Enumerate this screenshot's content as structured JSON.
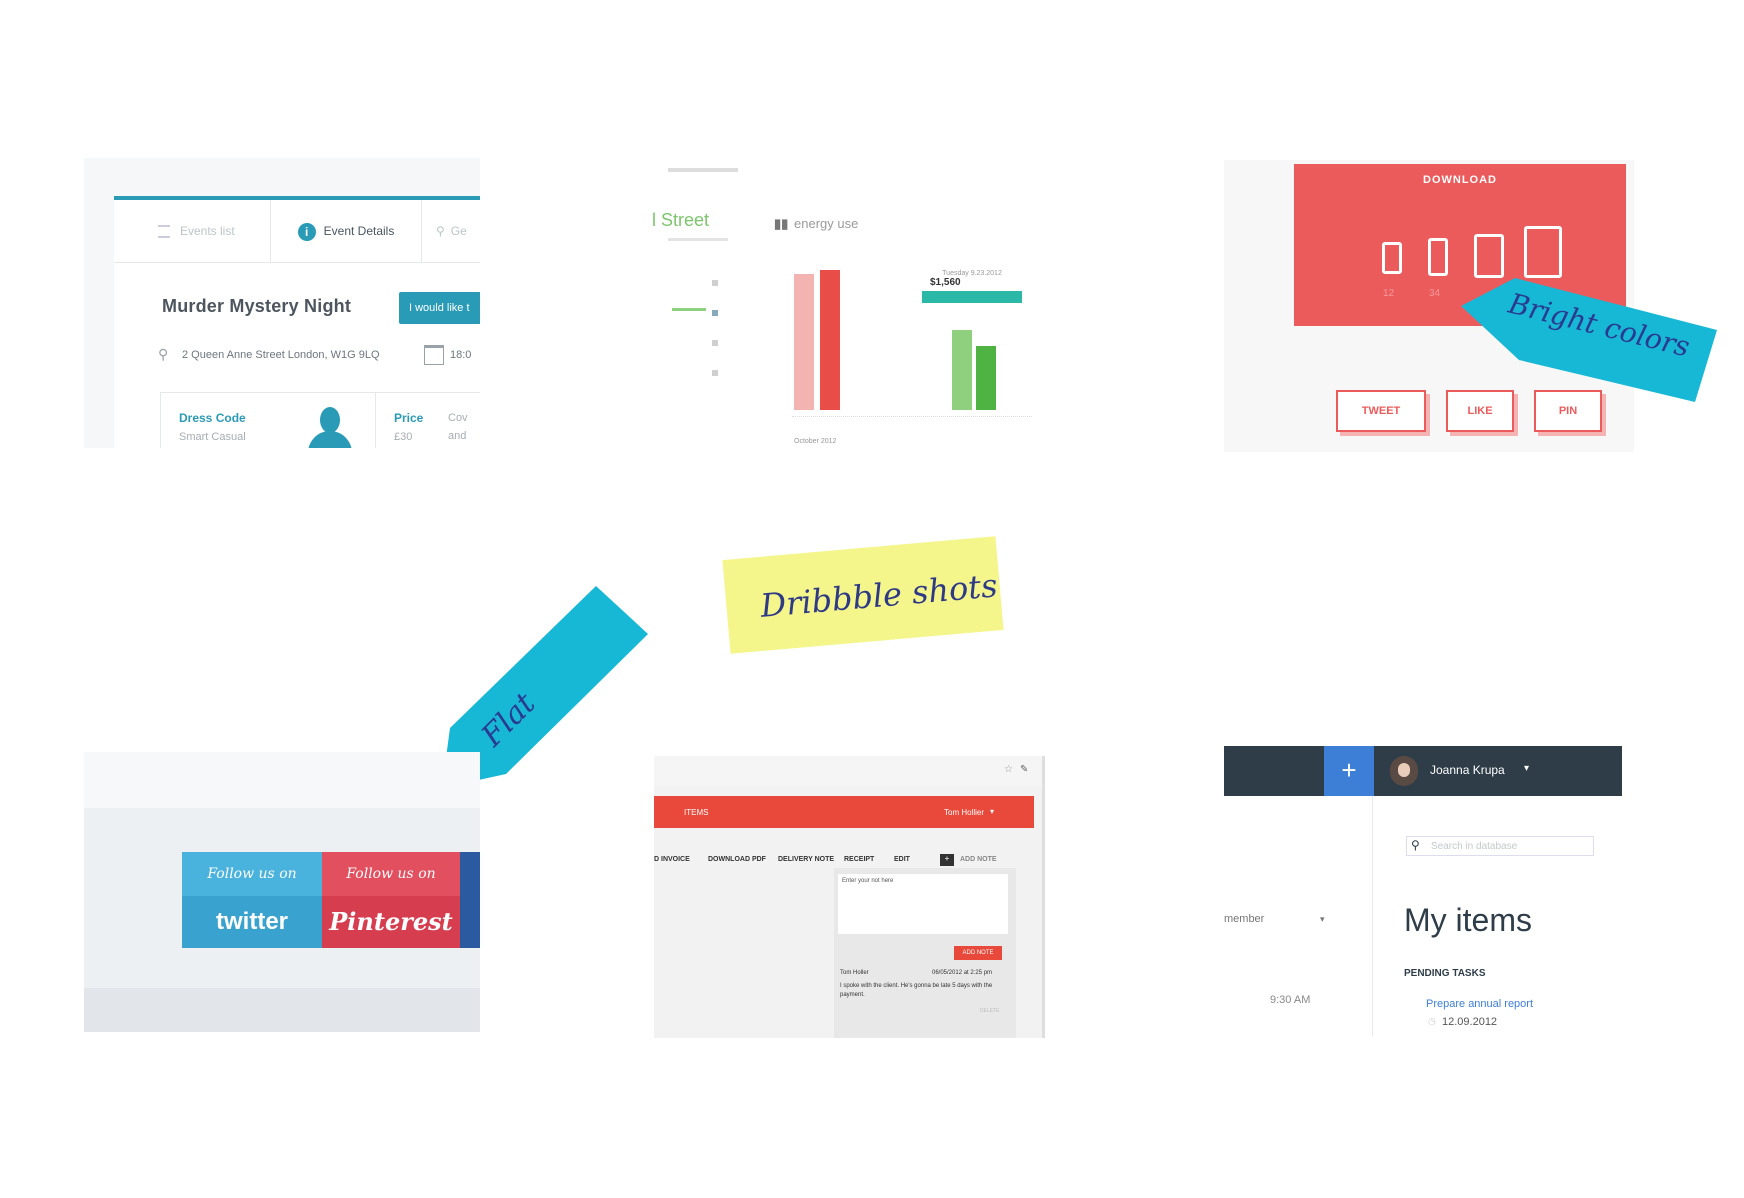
{
  "events": {
    "tabs": [
      "Events list",
      "Event Details",
      "Ge"
    ],
    "title": "Murder Mystery Night",
    "cta": "I would like t",
    "address": "2 Queen Anne Street London, W1G 9LQ",
    "time": "18:0",
    "dress_code_label": "Dress Code",
    "dress_code_value": "Smart Casual",
    "price_label": "Price",
    "price_value": "£30",
    "cov_label": "Cov",
    "cov_value": "and"
  },
  "energy": {
    "street": "l Street",
    "label": "energy use",
    "tooltip_date": "Tuesday 9.23.2012",
    "tooltip_value": "$1,560",
    "month": "October 2012"
  },
  "download": {
    "title": "DOWNLOAD",
    "nums": [
      "12",
      "34"
    ],
    "buttons": [
      "TWEET",
      "LIKE",
      "PIN"
    ]
  },
  "notes": {
    "bright": "Bright colors",
    "dribbble": "Dribbble shots",
    "flat": "Flat"
  },
  "social": {
    "follow1": "Follow us on",
    "brand1": "twitter",
    "follow2": "Follow us on",
    "brand2": "Pinterest"
  },
  "invoice": {
    "section": "ITEMS",
    "user": "Tom Hollier",
    "tabs": [
      "D INVOICE",
      "DOWNLOAD PDF",
      "DELIVERY NOTE",
      "RECEIPT",
      "EDIT",
      "ADD NOTE"
    ],
    "note_placeholder": "Enter your not here",
    "add_note": "ADD NOTE",
    "comment_user": "Tom Holler",
    "comment_date": "06/05/2012 at 2:25 pm",
    "comment_text": "I spoke with the client. He's gonna be late 5 days with the payment.",
    "delete": "DELETE"
  },
  "dashboard": {
    "user": "Joanna Krupa",
    "search_placeholder": "Search in database",
    "heading": "My items",
    "member": "member",
    "time": "9:30 AM",
    "pending": "PENDING TASKS",
    "task": "Prepare annual report",
    "task_date": "12.09.2012"
  },
  "colors": {
    "teal": "#2a9bb7",
    "red": "#ec5b5b",
    "cyan_note": "#17b7d6",
    "yellow_note": "#f4f58a",
    "twitter": "#4ab3dd",
    "pinterest": "#e2505f",
    "dash_dark": "#2e3d48",
    "dash_blue": "#3d7fd6",
    "invoice_red": "#e8493a"
  }
}
